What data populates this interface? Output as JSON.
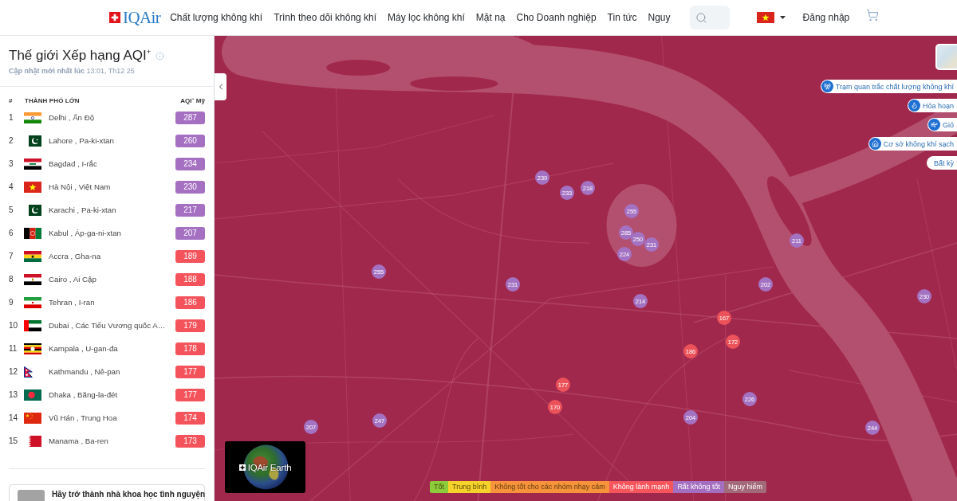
{
  "nav": {
    "logo": "IQAir",
    "links": [
      {
        "label": "Chất lượng không khí"
      },
      {
        "label": "Trình theo dõi không khí"
      },
      {
        "label": "Máy lọc không khí"
      },
      {
        "label": "Mặt nạ"
      },
      {
        "label": "Cho Doanh nghiệp"
      },
      {
        "label": "Tin tức"
      },
      {
        "label": "Nguy"
      }
    ],
    "login": "Đăng nhập"
  },
  "ranking": {
    "title": "Thế giới Xếp hạng AQI$^{+}$",
    "updated": "**Cập nhật mới nhất lúc** 13:01, Th12 25",
    "columns": [
      "#",
      "THÀNH PHỐ LỚN",
      "AQI$^{+}$ Mỹ"
    ],
    "rows": [
      {
        "rank": "1",
        "city": "Delhi , Ấn Độ",
        "aqi": "287",
        "color": "#a56fc2"
      },
      {
        "rank": "2",
        "city": "Lahore , Pa-ki-xtan",
        "aqi": "260",
        "color": "#a56fc2"
      },
      {
        "rank": "3",
        "city": "Bagdad , I-rắc",
        "aqi": "234",
        "color": "#a56fc2"
      },
      {
        "rank": "4",
        "city": "Hà Nội , Việt Nam",
        "aqi": "230",
        "color": "#a56fc2"
      },
      {
        "rank": "5",
        "city": "Karachi , Pa-ki-xtan",
        "aqi": "217",
        "color": "#a56fc2"
      },
      {
        "rank": "6",
        "city": "Kabul , Áp-ga-ni-xtan",
        "aqi": "207",
        "color": "#a56fc2"
      },
      {
        "rank": "7",
        "city": "Accra , Gha-na",
        "aqi": "189",
        "color": "#f5535b"
      },
      {
        "rank": "8",
        "city": "Cairo , Ai Cập",
        "aqi": "188",
        "color": "#f5535b"
      },
      {
        "rank": "9",
        "city": "Tehran , I-ran",
        "aqi": "186",
        "color": "#f5535b"
      },
      {
        "rank": "10",
        "city": "Dubai , Các Tiểu Vương quốc A…",
        "aqi": "179",
        "color": "#f5535b"
      },
      {
        "rank": "11",
        "city": "Kampala , U-gan-đa",
        "aqi": "178",
        "color": "#f5535b"
      },
      {
        "rank": "12",
        "city": "Kathmandu , Nê-pan",
        "aqi": "177",
        "color": "#f5535b"
      },
      {
        "rank": "13",
        "city": "Dhaka , Băng-la-đét",
        "aqi": "177",
        "color": "#f5535b"
      },
      {
        "rank": "14",
        "city": "Vũ Hán , Trung Hoa",
        "aqi": "174",
        "color": "#f5535b"
      },
      {
        "rank": "15",
        "city": "Manama , Ba-ren",
        "aqi": "173",
        "color": "#f5535b"
      }
    ],
    "promo": "Hãy trở thành nhà khoa học tình nguyện"
  },
  "map": {
    "layers": [
      {
        "label": "Trạm quan trắc chất lượng không khí"
      },
      {
        "label": "Hỏa hoạn"
      },
      {
        "label": "Gió"
      },
      {
        "label": "Cơ sở không khí sạch"
      },
      {
        "label": "Bất kỳ"
      }
    ],
    "markers": [
      {
        "value": "239",
        "color": "#a472c2"
      },
      {
        "value": "233",
        "color": "#a472c2"
      },
      {
        "value": "218",
        "color": "#a472c2"
      },
      {
        "value": "255",
        "color": "#a472c2"
      },
      {
        "value": "285",
        "color": "#a472c2"
      },
      {
        "value": "250",
        "color": "#a472c2"
      },
      {
        "value": "231",
        "color": "#a472c2"
      },
      {
        "value": "224",
        "color": "#a472c2"
      },
      {
        "value": "211",
        "color": "#a472c2"
      },
      {
        "value": "255",
        "color": "#a472c2"
      },
      {
        "value": "231",
        "color": "#a472c2"
      },
      {
        "value": "202",
        "color": "#a472c2"
      },
      {
        "value": "230",
        "color": "#a472c2"
      },
      {
        "value": "214",
        "color": "#a472c2"
      },
      {
        "value": "167",
        "color": "#ec5259"
      },
      {
        "value": "172",
        "color": "#ec5259"
      },
      {
        "value": "186",
        "color": "#ec5259"
      },
      {
        "value": "177",
        "color": "#ec5259"
      },
      {
        "value": "170",
        "color": "#ec5259"
      },
      {
        "value": "226",
        "color": "#a472c2"
      },
      {
        "value": "204",
        "color": "#a472c2"
      },
      {
        "value": "247",
        "color": "#a472c2"
      },
      {
        "value": "207",
        "color": "#a472c2"
      },
      {
        "value": "244",
        "color": "#a472c2"
      }
    ],
    "earth_badge": "IQAir Earth",
    "legend": [
      {
        "label": "Tốt",
        "color": "#8ccc3a"
      },
      {
        "label": "Trung bình",
        "color": "#f5d32a"
      },
      {
        "label": "Không tốt cho các nhóm nhạy cảm",
        "color": "#f7933b"
      },
      {
        "label": "Không lành mạnh",
        "color": "#f6555c"
      },
      {
        "label": "Rất không tốt",
        "color": "#a46fc1"
      },
      {
        "label": "Nguy hiểm",
        "color": "#a26a7b"
      }
    ]
  }
}
